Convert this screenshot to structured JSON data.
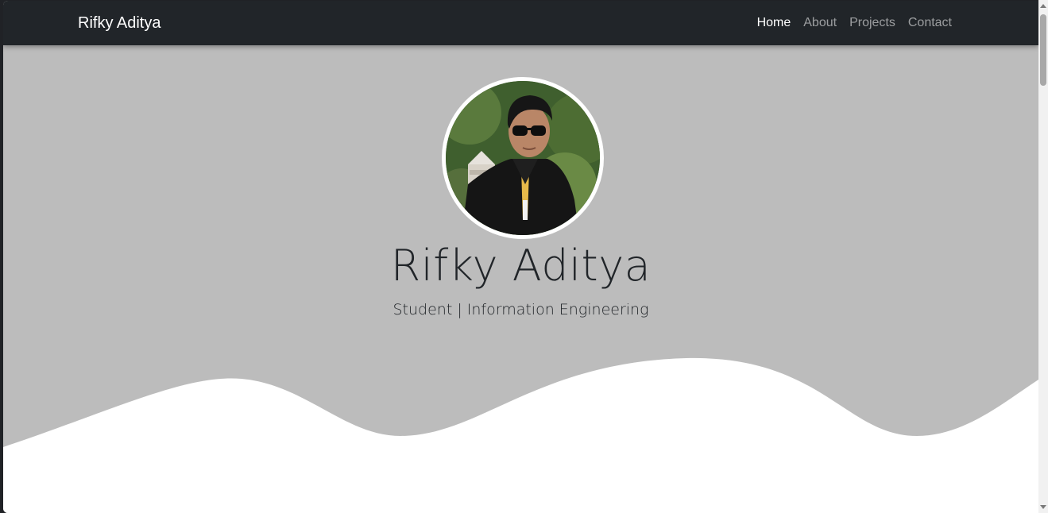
{
  "navbar": {
    "brand": "Rifky Aditya",
    "links": [
      {
        "label": "Home",
        "active": true
      },
      {
        "label": "About",
        "active": false
      },
      {
        "label": "Projects",
        "active": false
      },
      {
        "label": "Contact",
        "active": false
      }
    ]
  },
  "hero": {
    "name": "Rifky Aditya",
    "subtitle": "Student | Information Engineering",
    "avatar_icon": "profile-photo"
  },
  "colors": {
    "navbar_bg": "#212529",
    "hero_bg": "#bcbcbc",
    "wave_fill": "#ffffff"
  }
}
